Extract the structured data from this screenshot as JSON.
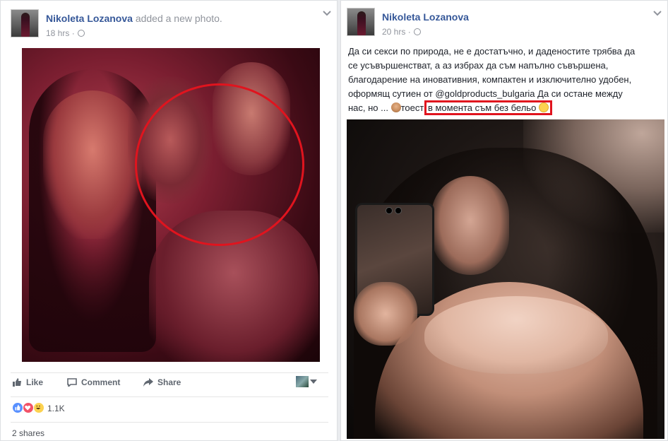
{
  "left_post": {
    "author": "Nikoleta Lozanova",
    "action": "added a new photo.",
    "time": "18 hrs",
    "photo_alt": "Selfie photo",
    "actions": {
      "like_label": "Like",
      "comment_label": "Comment",
      "share_label": "Share"
    },
    "reactions": {
      "icons": [
        "like-icon",
        "love-icon",
        "haha-icon"
      ],
      "count": "1.1K"
    },
    "shares": "2 shares"
  },
  "right_post": {
    "author": "Nikoleta Lozanova",
    "time": "20 hrs",
    "text_lines": [
      "Да си секси по природа, не е достатъчно, и даденостите трябва да",
      "се усъвършенстват, а аз избрах да съм напълно съвършена,",
      "благодарение на иновативния, компактен и изключително удобен,",
      "оформящ сутиен от @goldproducts_bulgaria Да си остане между"
    ],
    "last_line_start": "нас, но ... ",
    "last_line_mid": "тоест ",
    "highlighted": "в момента съм без бельо",
    "photo_alt": "Mirror selfie photo"
  },
  "colors": {
    "link": "#365899",
    "secondary": "#90949c",
    "highlight": "#e0141e",
    "like_blue": "#5890ff",
    "love_red": "#f25268",
    "haha_yellow": "#fcd250"
  }
}
